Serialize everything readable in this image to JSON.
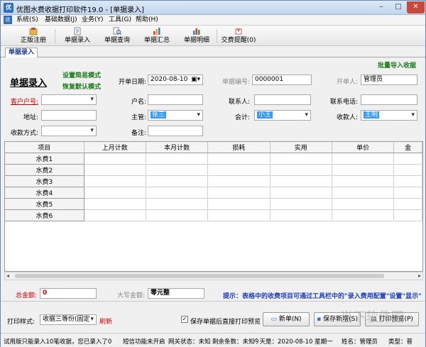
{
  "window": {
    "title": "优图水费收据打印软件19.0 - [单据录入]",
    "app_icon": "优",
    "min": "–",
    "max": "□",
    "close": "✕"
  },
  "menu": {
    "logo": "优",
    "items": [
      "系统(S)",
      "基础数据(J)",
      "业务(Y)",
      "工具(G)",
      "帮助(H)"
    ]
  },
  "toolbar": {
    "items": [
      {
        "label": "正版注册",
        "icon": "register-icon"
      },
      {
        "label": "单据录入",
        "icon": "document-entry-icon"
      },
      {
        "label": "单据查询",
        "icon": "document-search-icon"
      },
      {
        "label": "单据汇总",
        "icon": "summary-chart-icon"
      },
      {
        "label": "单据明细",
        "icon": "detail-chart-icon"
      },
      {
        "label": "交费提醒(0)",
        "icon": "reminder-icon"
      }
    ]
  },
  "tab": {
    "label": "单据录入"
  },
  "form": {
    "title": "单据录入",
    "mode_simple": "设置简易模式",
    "mode_default": "恢复默认模式",
    "batch_import": "批量导入收据",
    "open_date_label": "开单日期:",
    "open_date": "2020-08-10",
    "doc_no_label": "单据编号:",
    "doc_no": "0000001",
    "issuer_label": "开单人:",
    "issuer": "管理员",
    "customer_no_label": "客户户号:",
    "customer_no": "",
    "account_name_label": "户名:",
    "account_name": "",
    "contact_label": "联系人:",
    "contact": "",
    "phone_label": "联系电话:",
    "phone": "",
    "address_label": "地址:",
    "address": "",
    "supervisor_label": "主管:",
    "supervisor": "张三",
    "accountant_label": "会计:",
    "accountant": "小王",
    "receiver_label": "收款人:",
    "receiver": "王明",
    "pay_method_label": "收款方式:",
    "pay_method": "",
    "remark_label": "备注:",
    "remark": ""
  },
  "grid": {
    "columns": [
      "项目",
      "上月计数",
      "本月计数",
      "损耗",
      "实用",
      "单价",
      "金"
    ],
    "rows": [
      "水费1",
      "水费2",
      "水费3",
      "水费4",
      "水费5",
      "水费6"
    ]
  },
  "totals": {
    "total_label": "总金额:",
    "total_value": "0",
    "upper_label": "大写金额:",
    "upper_value": "零元整",
    "hint": "提示：表格中的收费项目可通过工具栏中的\"录入费用配置\"设置\"显示\""
  },
  "actions": {
    "print_style_label": "打印样式:",
    "print_style": "收据三等份(固定",
    "refresh": "刷新",
    "save_preview_label": "保存单据后直接打印预览",
    "new_btn": "新单(N)",
    "save_btn": "保存新增(S)",
    "print_btn": "打印预览(P)"
  },
  "status": {
    "trial": "试用版只能录入10笔收据，您已录入了0",
    "sms": "短信功能未开启",
    "network": "网关状态：未知",
    "remain": "剩余条数：未知",
    "today": "今天是：2020-08-10 星期一",
    "user": "姓名：管理员",
    "type": "类型：普"
  },
  "watermark": "当下软件园"
}
